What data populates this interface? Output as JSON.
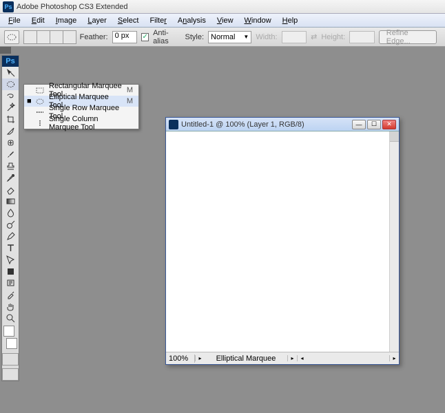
{
  "app": {
    "title": "Adobe Photoshop CS3 Extended",
    "badge": "Ps"
  },
  "menu": {
    "items": [
      {
        "html": "<u>F</u>ile"
      },
      {
        "html": "<u>E</u>dit"
      },
      {
        "html": "<u>I</u>mage"
      },
      {
        "html": "<u>L</u>ayer"
      },
      {
        "html": "<u>S</u>elect"
      },
      {
        "html": "Filte<u>r</u>"
      },
      {
        "html": "A<u>n</u>alysis"
      },
      {
        "html": "<u>V</u>iew"
      },
      {
        "html": "<u>W</u>indow"
      },
      {
        "html": "<u>H</u>elp"
      }
    ]
  },
  "options": {
    "feather_label": "Feather:",
    "feather_value": "0 px",
    "antialias_label": "Anti-alias",
    "antialias_checked": "✓",
    "style_label": "Style:",
    "style_value": "Normal",
    "width_label": "Width:",
    "height_label": "Height:",
    "refine": "Refine Edge..."
  },
  "flyout": {
    "items": [
      {
        "label": "Rectangular Marquee Tool",
        "shortcut": "M",
        "selected": false,
        "icon": "rect"
      },
      {
        "label": "Elliptical Marquee Tool",
        "shortcut": "M",
        "selected": true,
        "icon": "ellipse"
      },
      {
        "label": "Single Row Marquee Tool",
        "shortcut": "",
        "selected": false,
        "icon": "row"
      },
      {
        "label": "Single Column Marquee Tool",
        "shortcut": "",
        "selected": false,
        "icon": "col"
      }
    ]
  },
  "document": {
    "title": "Untitled-1 @ 100% (Layer 1, RGB/8)",
    "zoom": "100%",
    "status_tool": "Elliptical Marquee"
  },
  "tools": [
    "move",
    "marquee",
    "lasso",
    "wand",
    "crop",
    "slice",
    "heal",
    "brush",
    "stamp",
    "history",
    "eraser",
    "gradient",
    "blur",
    "dodge",
    "pen",
    "type",
    "path",
    "shape",
    "notes",
    "eyedrop",
    "hand",
    "zoom"
  ]
}
